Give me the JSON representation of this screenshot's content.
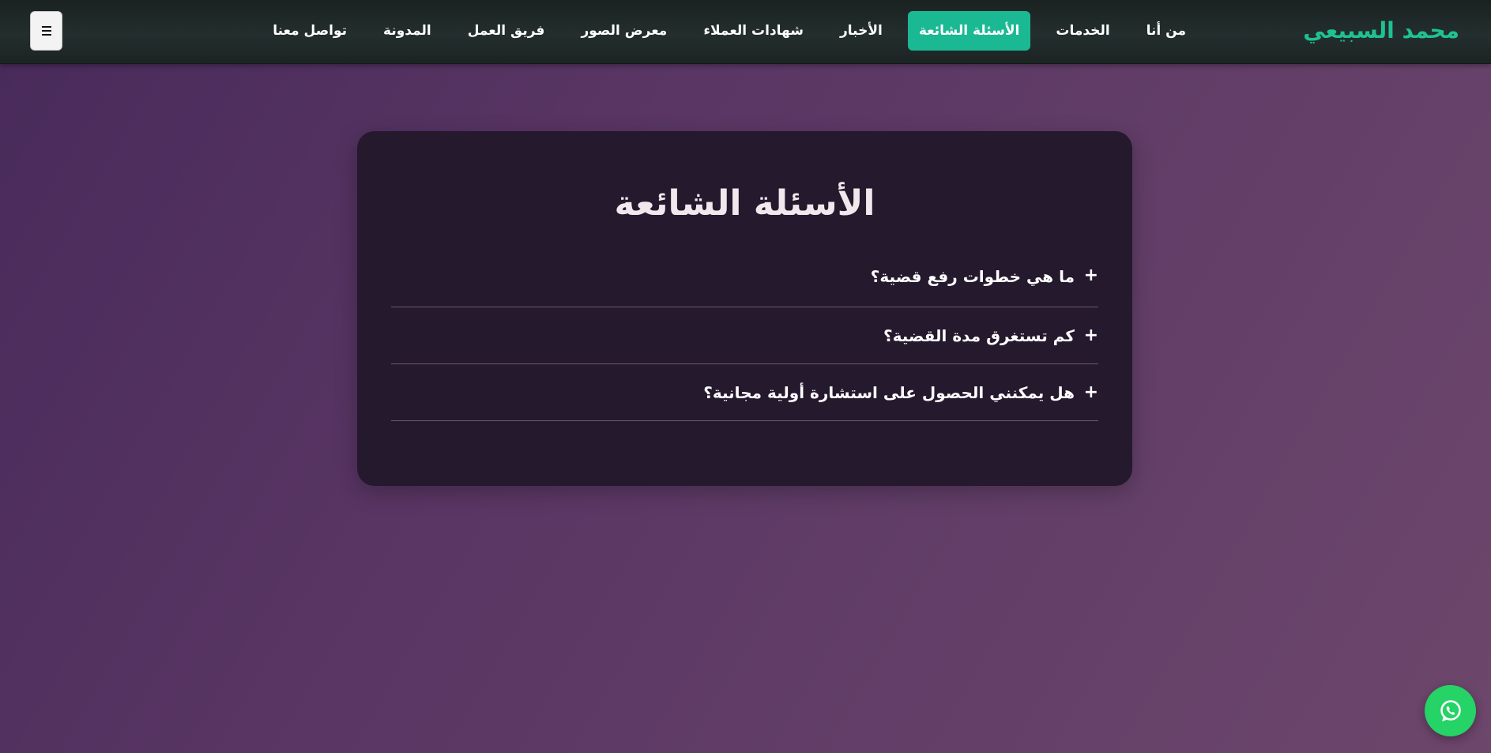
{
  "nav": {
    "brand": "محمد السبيعي",
    "links": [
      {
        "label": "من أنا",
        "active": false
      },
      {
        "label": "الخدمات",
        "active": false
      },
      {
        "label": "الأسئلة الشائعة",
        "active": true
      },
      {
        "label": "الأخبار",
        "active": false
      },
      {
        "label": "شهادات العملاء",
        "active": false
      },
      {
        "label": "معرض الصور",
        "active": false
      },
      {
        "label": "فريق العمل",
        "active": false
      },
      {
        "label": "المدونة",
        "active": false
      },
      {
        "label": "تواصل معنا",
        "active": false
      }
    ],
    "menu_icon": "hamburger-icon"
  },
  "faq": {
    "title": "الأسئلة الشائعة",
    "expand_symbol": "+",
    "items": [
      {
        "question": "ما هي خطوات رفع قضية؟"
      },
      {
        "question": "كم تستغرق مدة القضية؟"
      },
      {
        "question": "هل يمكنني الحصول على استشارة أولية مجانية؟"
      }
    ]
  },
  "floating": {
    "whatsapp_icon": "whatsapp-icon"
  },
  "colors": {
    "accent": "#1bb894",
    "brand_text": "#1fc193",
    "whatsapp": "#25d366"
  }
}
